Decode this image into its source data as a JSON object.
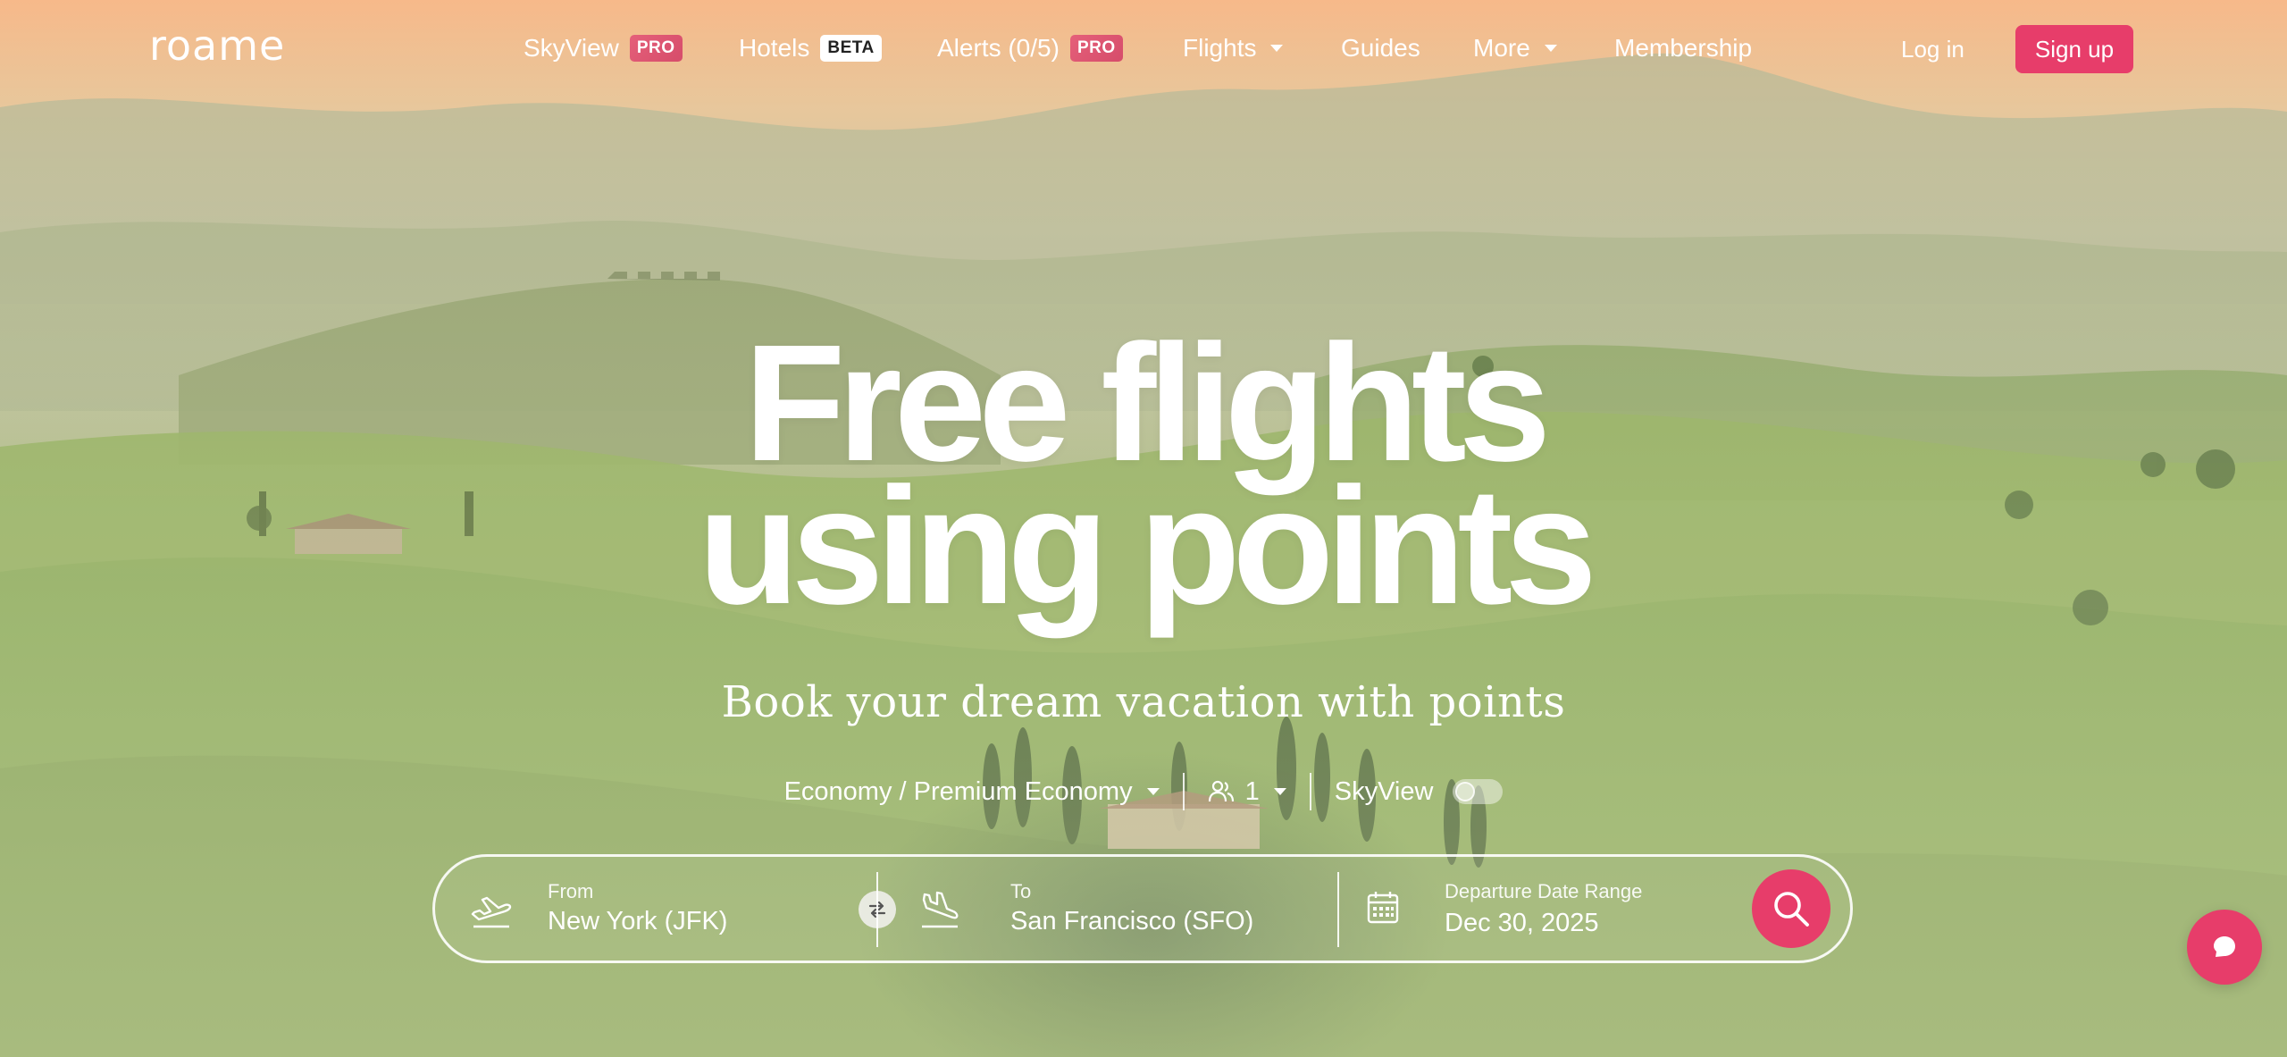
{
  "brand": {
    "logo": "roame",
    "accent": "#e73d6a"
  },
  "nav": {
    "items": [
      {
        "label": "SkyView",
        "badge": "PRO"
      },
      {
        "label": "Hotels",
        "badge": "BETA"
      },
      {
        "label": "Alerts (0/5)",
        "badge": "PRO"
      },
      {
        "label": "Flights",
        "dropdown": true
      },
      {
        "label": "Guides"
      },
      {
        "label": "More",
        "dropdown": true
      },
      {
        "label": "Membership"
      }
    ],
    "login": "Log in",
    "signup": "Sign up"
  },
  "hero": {
    "line1": "Free flights",
    "line2": "using points",
    "subtitle": "Book your dream vacation with points"
  },
  "options": {
    "cabin": "Economy / Premium Economy",
    "passengers": "1",
    "skyview_label": "SkyView",
    "skyview_enabled": false
  },
  "search": {
    "from_label": "From",
    "from_value": "New York (JFK)",
    "to_label": "To",
    "to_value": "San Francisco (SFO)",
    "date_label": "Departure Date Range",
    "date_value": "Dec 30, 2025"
  },
  "icons": [
    "takeoff-icon",
    "swap-icon",
    "landing-icon",
    "calendar-icon",
    "search-icon",
    "passengers-icon",
    "chat-icon"
  ]
}
